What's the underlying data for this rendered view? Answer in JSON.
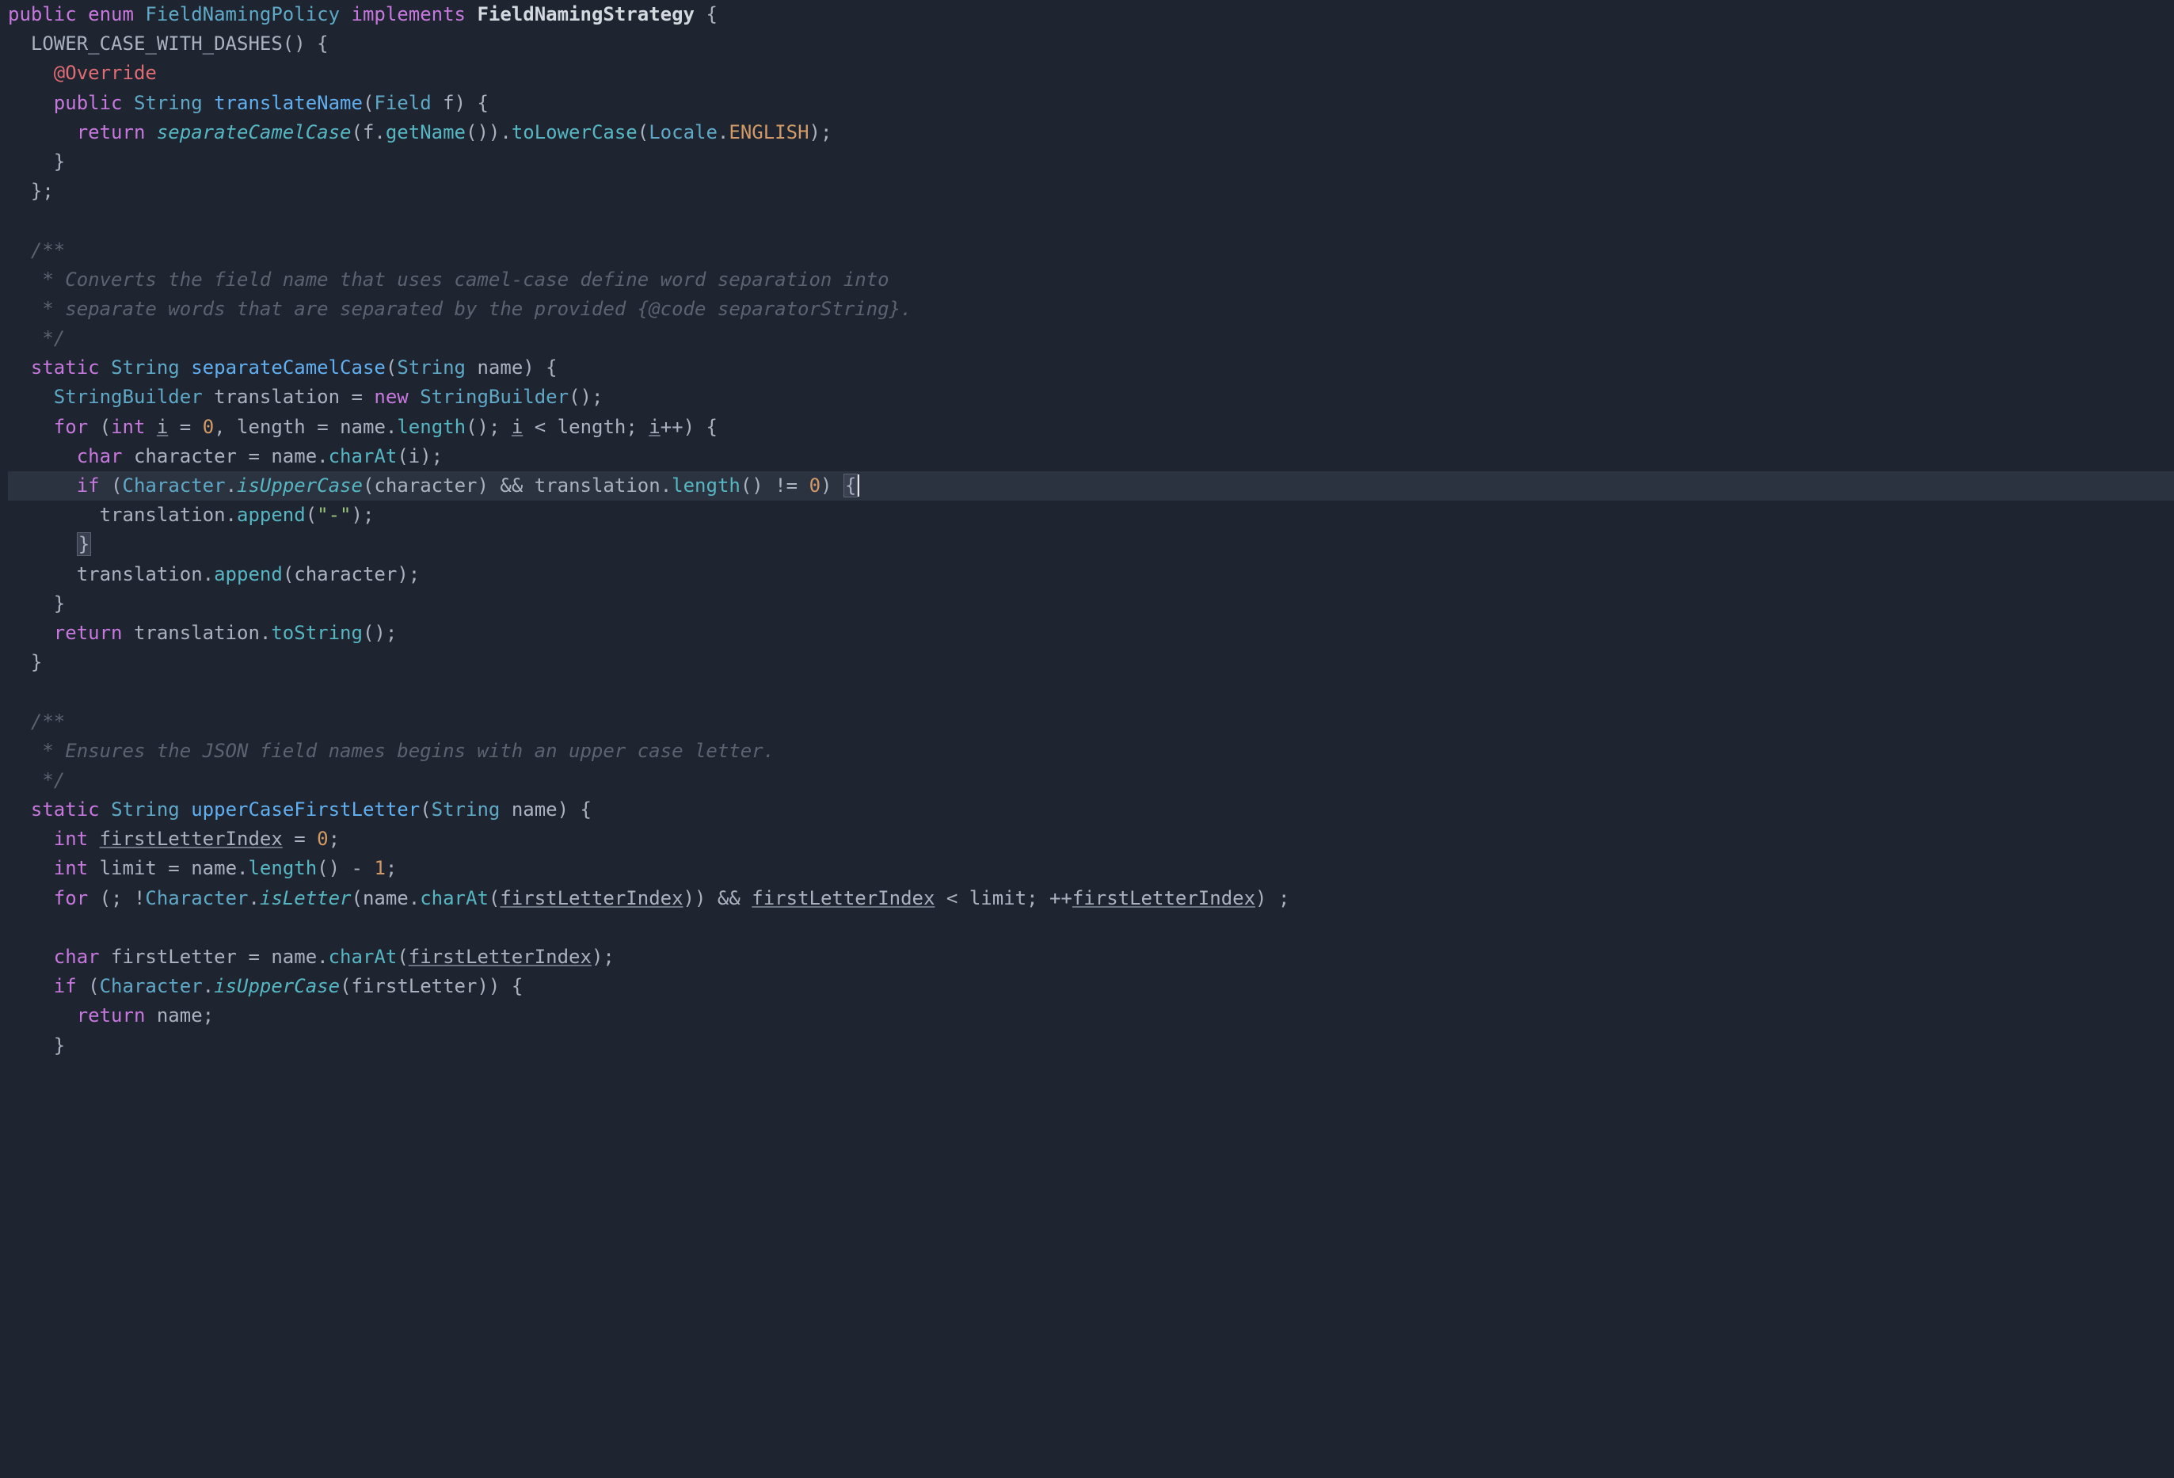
{
  "line0": {
    "kw_public": "public",
    "kw_enum": "enum",
    "cls": "FieldNamingPolicy",
    "kw_impl": "implements",
    "iface": "FieldNamingStrategy",
    "brace": "{"
  },
  "line1": {
    "const": "LOWER_CASE_WITH_DASHES",
    "paren": "()",
    "brace": " {"
  },
  "line2": {
    "anno": "@Override"
  },
  "line3": {
    "kw_public": "public",
    "ret": "String",
    "name": "translateName",
    "lp": "(",
    "ptype": "Field",
    "pname": "f",
    "rp_brace": ") {"
  },
  "line4": {
    "kw_return": "return",
    "m1": "separateCamelCase",
    "lp": "(",
    "v": "f",
    "dot": ".",
    "m2": "getName",
    "call": "()).",
    "m3": "toLowerCase",
    "lp2": "(",
    "cls": "Locale",
    "dot2": ".",
    "const": "ENGLISH",
    "end": ");"
  },
  "line5": {
    "brace": "}"
  },
  "line6": {
    "brace": "};"
  },
  "line8": {
    "open": "/**"
  },
  "line9": {
    "text": " * Converts the field name that uses camel-case define word separation into"
  },
  "line10": {
    "text": " * separate words that are separated by the provided {",
    "tag": "@code",
    "rest": " separatorString}."
  },
  "line11": {
    "close": " */"
  },
  "line12": {
    "kw_static": "static",
    "ret": "String",
    "name": "separateCamelCase",
    "lp": "(",
    "ptype": "String",
    "pname": "name",
    "rp_brace": ") {"
  },
  "line13": {
    "type": "StringBuilder",
    "var": "translation",
    "eq": " = ",
    "kw_new": "new",
    "ctor": "StringBuilder",
    "end": "();"
  },
  "line14": {
    "kw_for": "for",
    "open": " (",
    "kw_int": "int",
    "v_i": "i",
    "eq": " = ",
    "zero": "0",
    "comma": ", ",
    "v_len": "length",
    "eq2": " = ",
    "nm": "name",
    "dot": ".",
    "m": "length",
    "call": "(); ",
    "v_i2": "i",
    "lt": " < ",
    "v_len2": "length",
    "semi": "; ",
    "v_i3": "i",
    "inc": "++",
    "close": ") {"
  },
  "line15": {
    "kw_char": "char",
    "var": "character",
    "eq": " = ",
    "nm": "name",
    "dot": ".",
    "m": "charAt",
    "lp": "(",
    "arg": "i",
    "rp": ");"
  },
  "line16": {
    "kw_if": "if",
    "open": " (",
    "cls": "Character",
    "dot": ".",
    "m": "isUpperCase",
    "lp": "(",
    "arg": "character",
    "rp": ") ",
    "and": "&&",
    "sp": " ",
    "tr": "translation",
    "dot2": ".",
    "m2": "length",
    "call": "() ",
    "ne": "!=",
    "sp2": " ",
    "zero": "0",
    "rp2": ") ",
    "brace": "{"
  },
  "line17": {
    "tr": "translation",
    "dot": ".",
    "m": "append",
    "lp": "(",
    "str": "\"-\"",
    "rp": ");"
  },
  "line18": {
    "brace": "}"
  },
  "line19": {
    "tr": "translation",
    "dot": ".",
    "m": "append",
    "lp": "(",
    "arg": "character",
    "rp": ");"
  },
  "line20": {
    "brace": "}"
  },
  "line21": {
    "kw_return": "return",
    "tr": "translation",
    "dot": ".",
    "m": "toString",
    "end": "();"
  },
  "line22": {
    "brace": "}"
  },
  "line24": {
    "open": "/**"
  },
  "line25": {
    "text": " * Ensures the JSON field names begins with an upper case letter."
  },
  "line26": {
    "close": " */"
  },
  "line27": {
    "kw_static": "static",
    "ret": "String",
    "name": "upperCaseFirstLetter",
    "lp": "(",
    "ptype": "String",
    "pname": "name",
    "rp_brace": ") {"
  },
  "line28": {
    "kw_int": "int",
    "var": "firstLetterIndex",
    "eq": " = ",
    "zero": "0",
    "semi": ";"
  },
  "line29": {
    "kw_int": "int",
    "var": "limit",
    "eq": " = ",
    "nm": "name",
    "dot": ".",
    "m": "length",
    "call": "() ",
    "minus": "-",
    "sp": " ",
    "one": "1",
    "semi": ";"
  },
  "line30": {
    "kw_for": "for",
    "open": " (; !",
    "cls": "Character",
    "dot": ".",
    "m": "isLetter",
    "lp": "(",
    "nm": "name",
    "dot2": ".",
    "m2": "charAt",
    "lp2": "(",
    "arg": "firstLetterIndex",
    "rp": ")) ",
    "and": "&&",
    "sp": " ",
    "arg2": "firstLetterIndex",
    "lt": " < ",
    "lim": "limit",
    "semi": "; ++",
    "arg3": "firstLetterIndex",
    "close": ") ;"
  },
  "line32": {
    "kw_char": "char",
    "var": "firstLetter",
    "eq": " = ",
    "nm": "name",
    "dot": ".",
    "m": "charAt",
    "lp": "(",
    "arg": "firstLetterIndex",
    "rp": ");"
  },
  "line33": {
    "kw_if": "if",
    "open": " (",
    "cls": "Character",
    "dot": ".",
    "m": "isUpperCase",
    "lp": "(",
    "arg": "firstLetter",
    "rp": ")) {"
  },
  "line34": {
    "kw_return": "return",
    "nm": "name",
    "semi": ";"
  },
  "line35": {
    "brace": "}"
  }
}
